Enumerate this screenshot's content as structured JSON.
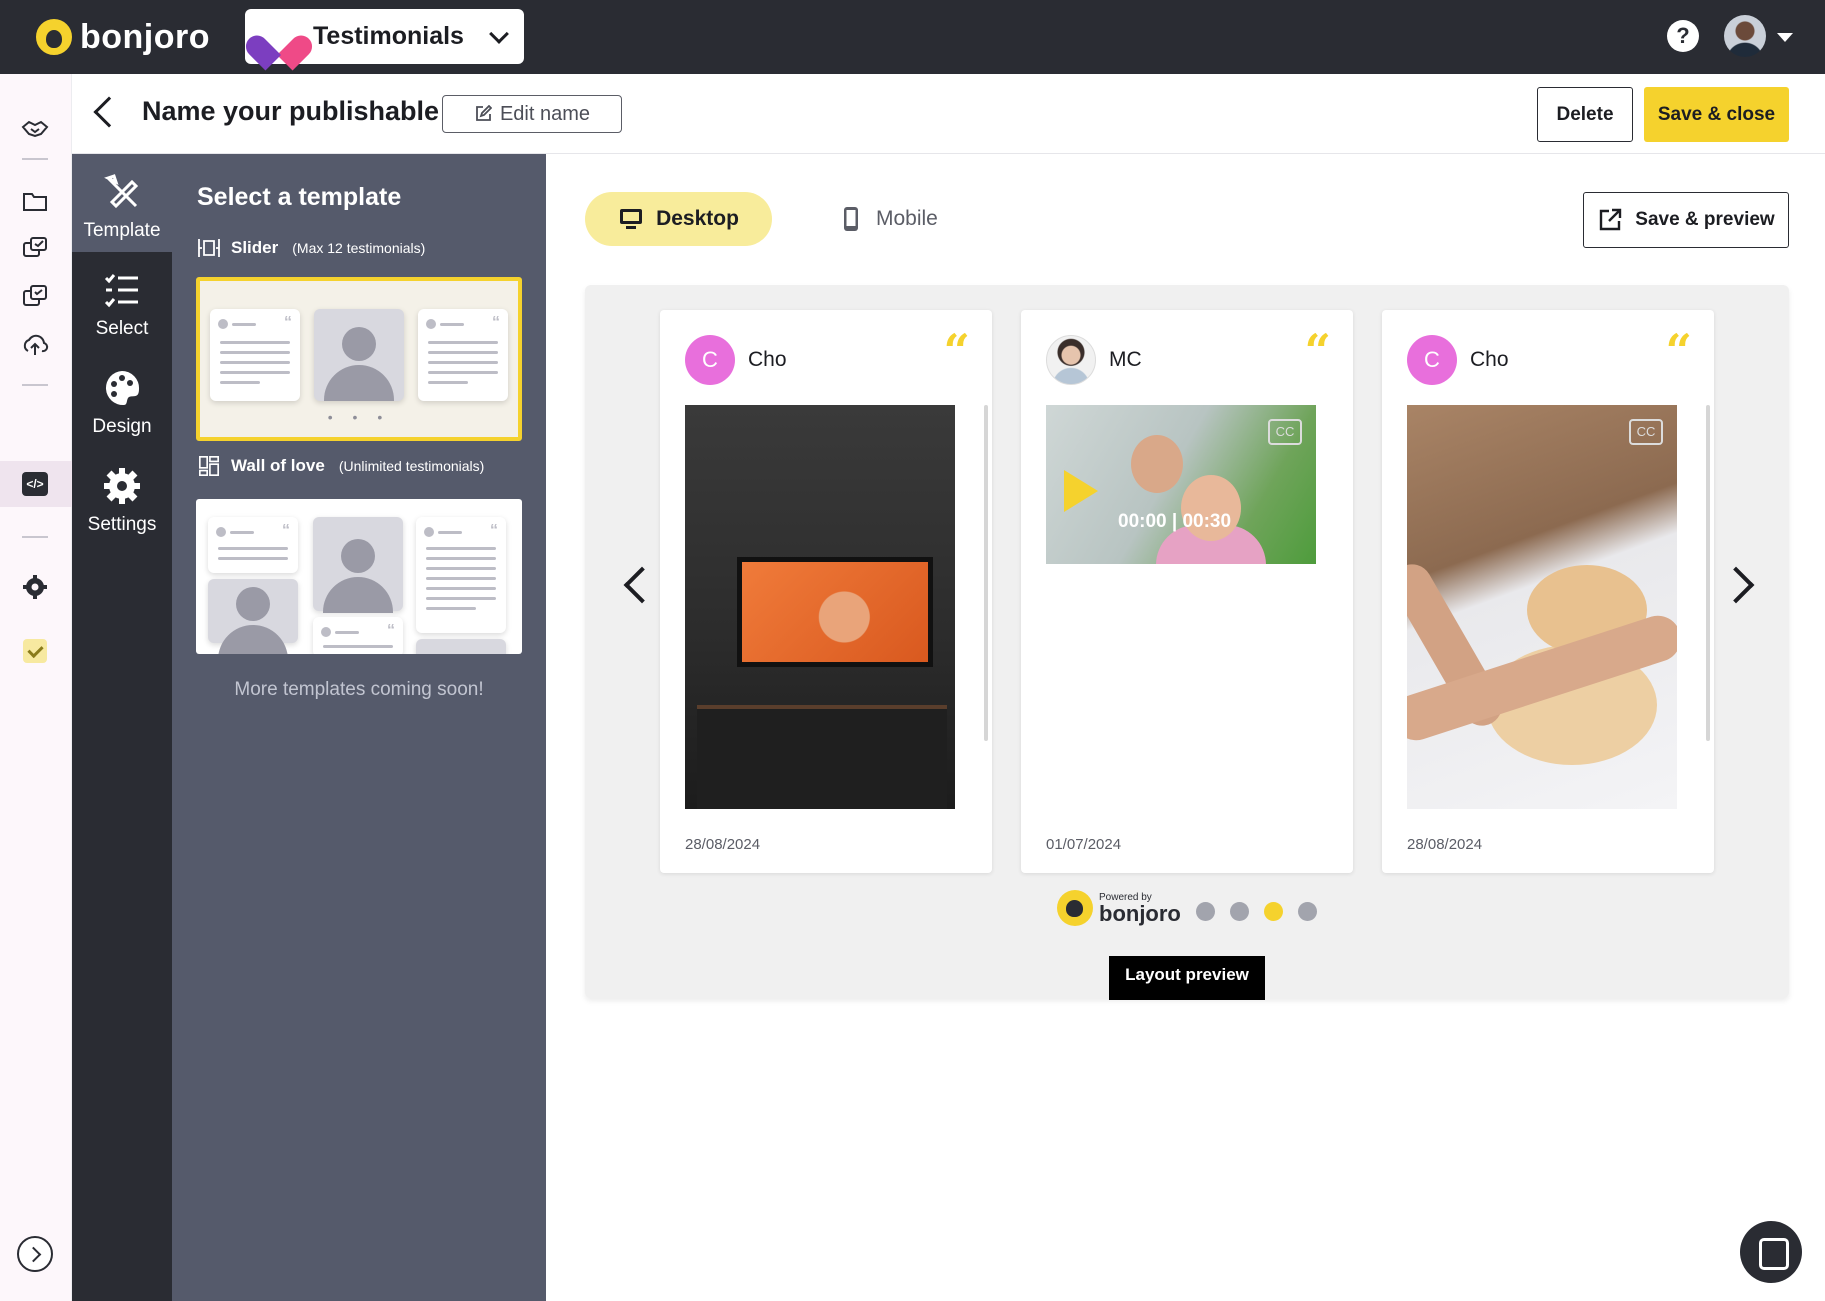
{
  "app": {
    "brand": "bonjoro",
    "project": "Testimonials",
    "help_label": "?"
  },
  "header": {
    "title": "Name your publishable",
    "edit_name": "Edit name",
    "delete": "Delete",
    "save_close": "Save & close"
  },
  "tabs": [
    {
      "label": "Template",
      "icon": "pencil-ruler-icon",
      "active": true
    },
    {
      "label": "Select",
      "icon": "checklist-icon",
      "active": false
    },
    {
      "label": "Design",
      "icon": "palette-icon",
      "active": false
    },
    {
      "label": "Settings",
      "icon": "gear-icon",
      "active": false
    }
  ],
  "panel": {
    "title": "Select a template",
    "slider": {
      "label": "Slider",
      "note": "(Max 12 testimonials)",
      "dots": "• • •"
    },
    "wall": {
      "label": "Wall of love",
      "note": "(Unlimited testimonials)"
    },
    "coming_soon": "More templates coming soon!"
  },
  "view": {
    "desktop": "Desktop",
    "mobile": "Mobile",
    "save_preview": "Save & preview"
  },
  "testimonials": [
    {
      "initial": "C",
      "name": "Cho",
      "date": "28/08/2024",
      "media": "tv-photo",
      "quote": "“"
    },
    {
      "initial": "",
      "name": "MC",
      "date": "01/07/2024",
      "media": "video",
      "time": "00:00 | 00:30",
      "cc": "CC",
      "quote": "“"
    },
    {
      "initial": "C",
      "name": "Cho",
      "date": "28/08/2024",
      "media": "cat-photo",
      "cc": "CC",
      "quote": "“"
    }
  ],
  "pagination": {
    "count": 4,
    "active_index": 2
  },
  "powered": {
    "small": "Powered by",
    "brand": "bonjoro"
  },
  "layout_preview": "Layout preview",
  "colors": {
    "accent": "#f5d22d",
    "topbar": "#2a2c33",
    "panel": "#555a6b",
    "avatar": "#e86fdc"
  }
}
